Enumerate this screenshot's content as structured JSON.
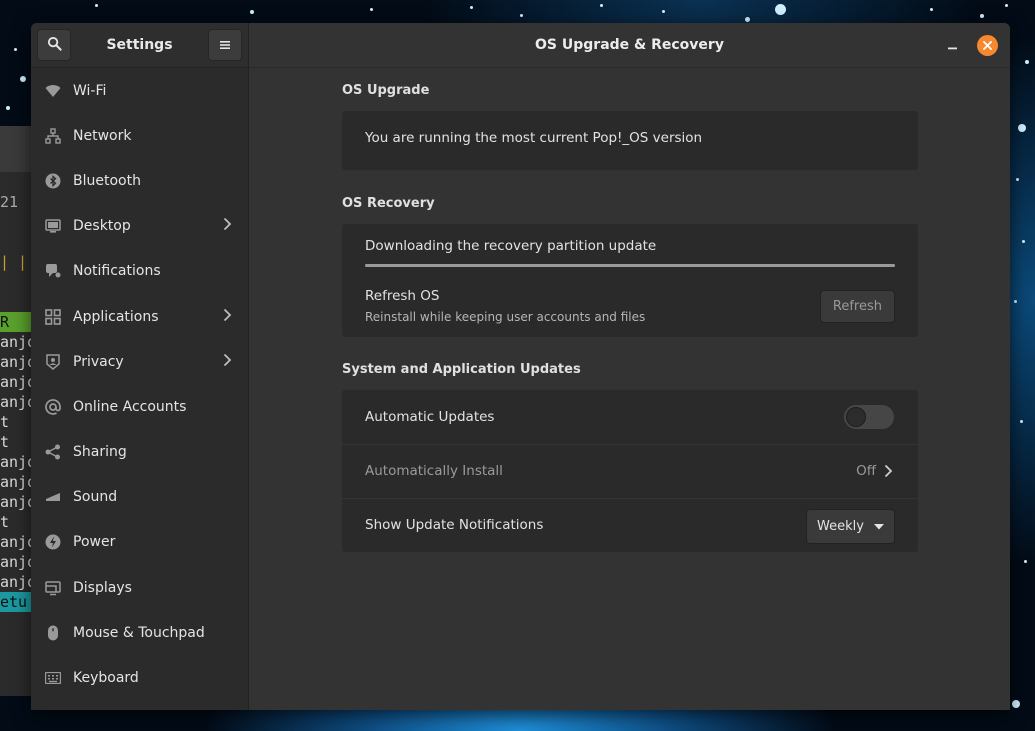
{
  "sidebar": {
    "title": "Settings",
    "items": [
      {
        "label": "Wi-Fi",
        "icon": "wifi-icon",
        "has_chevron": false
      },
      {
        "label": "Network",
        "icon": "network-icon",
        "has_chevron": false
      },
      {
        "label": "Bluetooth",
        "icon": "bluetooth-icon",
        "has_chevron": false
      },
      {
        "label": "Desktop",
        "icon": "desktop-icon",
        "has_chevron": true
      },
      {
        "label": "Notifications",
        "icon": "notifications-icon",
        "has_chevron": false
      },
      {
        "label": "Applications",
        "icon": "applications-icon",
        "has_chevron": true
      },
      {
        "label": "Privacy",
        "icon": "privacy-icon",
        "has_chevron": true
      },
      {
        "label": "Online Accounts",
        "icon": "at-sign-icon",
        "has_chevron": false
      },
      {
        "label": "Sharing",
        "icon": "share-icon",
        "has_chevron": false
      },
      {
        "label": "Sound",
        "icon": "sound-icon",
        "has_chevron": false
      },
      {
        "label": "Power",
        "icon": "power-icon",
        "has_chevron": false
      },
      {
        "label": "Displays",
        "icon": "displays-icon",
        "has_chevron": false
      },
      {
        "label": "Mouse & Touchpad",
        "icon": "mouse-icon",
        "has_chevron": false
      },
      {
        "label": "Keyboard",
        "icon": "keyboard-icon",
        "has_chevron": false
      }
    ]
  },
  "header": {
    "title": "OS Upgrade & Recovery"
  },
  "sections": {
    "upgrade": {
      "label": "OS Upgrade",
      "status": "You are running the most current Pop!_OS version"
    },
    "recovery": {
      "label": "OS Recovery",
      "download_status": "Downloading the recovery partition update",
      "progress": 1.0,
      "refresh_title": "Refresh OS",
      "refresh_subtitle": "Reinstall while keeping user accounts and files",
      "refresh_button": "Refresh"
    },
    "updates": {
      "label": "System and Application Updates",
      "automatic_updates": "Automatic Updates",
      "automatic_updates_on": false,
      "automatically_install": "Automatically Install",
      "automatically_install_value": "Off",
      "show_notifications": "Show Update Notifications",
      "notifications_value": "Weekly"
    }
  },
  "terminal": {
    "lines": [
      "21",
      "",
      "",
      "| |",
      "",
      "R",
      "anjo",
      "anjo",
      "anjo",
      "anjo",
      "t",
      "t",
      "anjo",
      "anjo",
      "anjo",
      "t",
      "anjo",
      "anjo",
      "anjo",
      "etu"
    ]
  },
  "colors": {
    "accent_close": "#f6882f",
    "window_bg": "#333333",
    "sidebar_bg": "#2b2b2b",
    "card_bg": "#2a2a2a"
  }
}
